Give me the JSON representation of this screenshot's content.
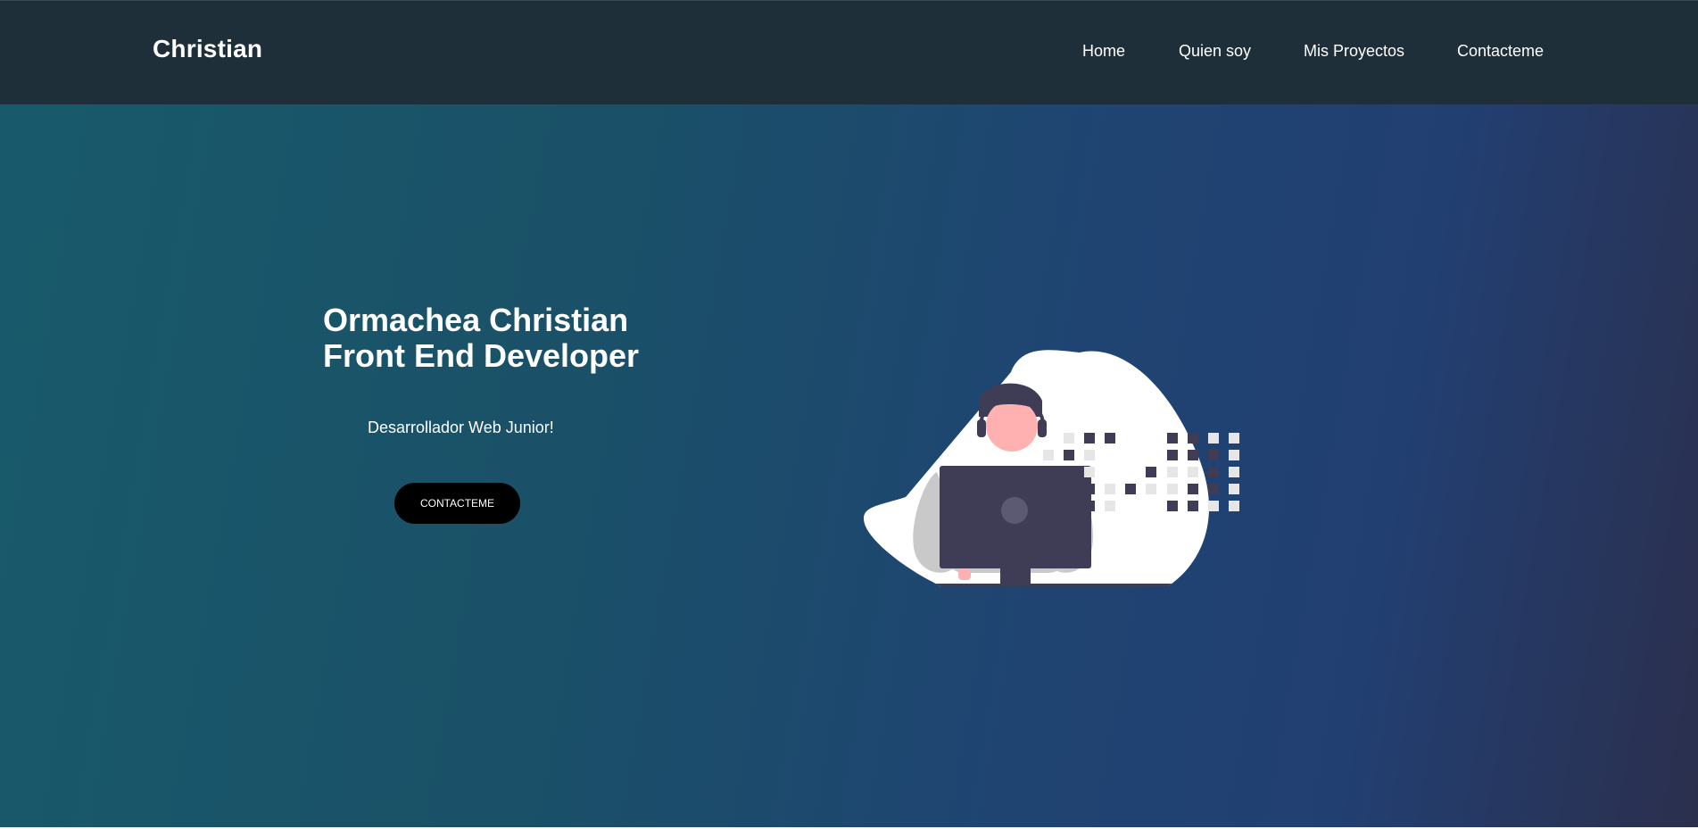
{
  "navbar": {
    "brand": "Christian",
    "links": [
      {
        "label": "Home"
      },
      {
        "label": "Quien soy"
      },
      {
        "label": "Mis Proyectos"
      },
      {
        "label": "Contacteme"
      }
    ]
  },
  "hero": {
    "title_line1": "Ormachea Christian",
    "title_line2": "Front End Developer",
    "subtitle": "Desarrollador Web Junior!",
    "cta_label": "CONTACTEME"
  },
  "colors": {
    "navbar_bg": "#1e2f3a",
    "hero_gradient_start": "#185a6b",
    "hero_gradient_end": "#2b2f4d",
    "button_bg": "#000000"
  },
  "illustration": {
    "icon": "developer-with-headset-at-computer-illustration"
  }
}
